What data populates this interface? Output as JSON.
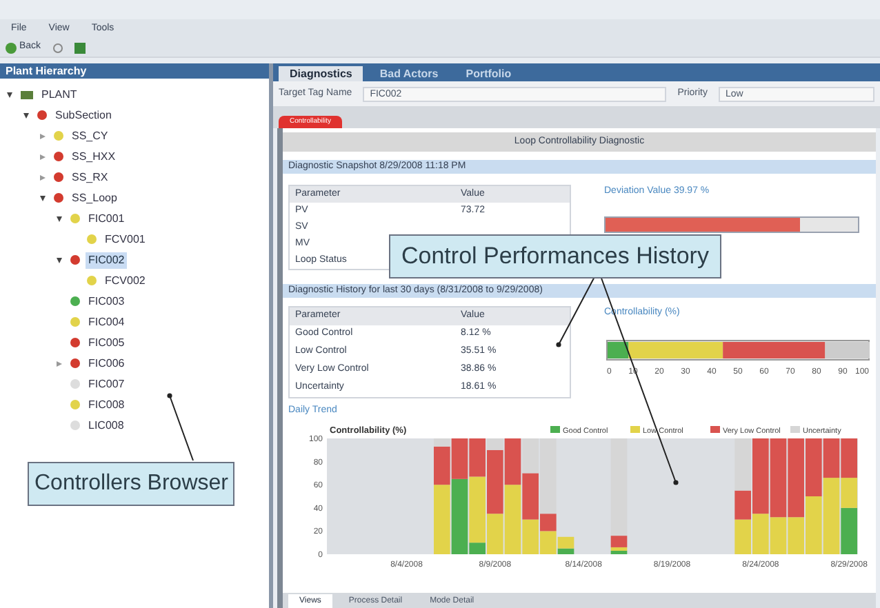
{
  "menu": [
    "File",
    "View",
    "Tools"
  ],
  "toolbar": {
    "back": "Back"
  },
  "hierarchy": {
    "title": "Plant Hierarchy",
    "tree": [
      {
        "label": "PLANT",
        "expanded": true,
        "selected": false,
        "children": [
          {
            "label": "SubSection",
            "color": "#d33b2f",
            "expanded": true,
            "selected": false,
            "children": [
              {
                "label": "SS_CY",
                "color": "#e2d34a",
                "expanded": false,
                "selected": false
              },
              {
                "label": "SS_HXX",
                "color": "#d33b2f",
                "expanded": false,
                "selected": false
              },
              {
                "label": "SS_RX",
                "color": "#d33b2f",
                "expanded": false,
                "selected": false
              },
              {
                "label": "SS_Loop",
                "color": "#d33b2f",
                "expanded": true,
                "selected": false,
                "children": [
                  {
                    "label": "FIC001",
                    "color": "#e2d34a",
                    "expanded": true,
                    "selected": false,
                    "children": [
                      {
                        "label": "FCV001",
                        "color": "#e2d34a",
                        "selected": false
                      }
                    ]
                  },
                  {
                    "label": "FIC002",
                    "color": "#d33b2f",
                    "expanded": true,
                    "selected": true,
                    "children": [
                      {
                        "label": "FCV002",
                        "color": "#e2d34a",
                        "selected": false
                      }
                    ]
                  },
                  {
                    "label": "FIC003",
                    "color": "#4caf50",
                    "selected": false
                  },
                  {
                    "label": "FIC004",
                    "color": "#e2d34a",
                    "selected": false
                  },
                  {
                    "label": "FIC005",
                    "color": "#d33b2f",
                    "selected": false
                  },
                  {
                    "label": "FIC006",
                    "color": "#d33b2f",
                    "expanded": false,
                    "selected": false
                  },
                  {
                    "label": "FIC007",
                    "color": "#dddddd",
                    "selected": false
                  },
                  {
                    "label": "FIC008",
                    "color": "#e2d34a",
                    "selected": false
                  },
                  {
                    "label": "LIC008",
                    "color": "#dddddd",
                    "selected": false
                  }
                ]
              }
            ]
          }
        ]
      }
    ]
  },
  "tabs": [
    {
      "label": "Diagnostics",
      "selected": true
    },
    {
      "label": "Bad Actors",
      "selected": false
    },
    {
      "label": "Portfolio",
      "selected": false
    }
  ],
  "target": {
    "label": "Target Tag Name",
    "value": "FIC002"
  },
  "priority": {
    "label": "Priority",
    "value": "Low"
  },
  "status_tab": {
    "label": "Controllability"
  },
  "panel_title": "Loop Controllability Diagnostic",
  "snapshot": {
    "title": "Diagnostic Snapshot 8/29/2008 11:18 PM",
    "columns": [
      "Parameter",
      "Value"
    ],
    "rows": [
      [
        "PV",
        "73.72"
      ],
      [
        "SV",
        ""
      ],
      [
        "MV",
        ""
      ],
      [
        "Loop Status",
        ""
      ]
    ],
    "meter_title": "Deviation Value 39.97 %",
    "level": 0.77
  },
  "history": {
    "title": "Diagnostic History for last 30 days (8/31/2008 to 9/29/2008)",
    "columns": [
      "Parameter",
      "Value"
    ],
    "rows": [
      [
        "Good Control",
        "8.12 %"
      ],
      [
        "Low Control",
        "35.51 %"
      ],
      [
        "Very Low Control",
        "38.86 %"
      ],
      [
        "Uncertainty",
        "18.61 %"
      ]
    ],
    "bar_title": "Controllability (%)",
    "chart_data": {
      "type": "bar",
      "orientation": "horizontal",
      "stacked": true,
      "categories": [
        null
      ],
      "xlim": [
        0,
        100
      ],
      "xticks": [
        0,
        10,
        20,
        30,
        40,
        50,
        60,
        70,
        80,
        90,
        100
      ],
      "series": [
        {
          "color": "#4caf50",
          "values": [
            8
          ]
        },
        {
          "color": "#e2d34a",
          "values": [
            36
          ]
        },
        {
          "color": "#d9534f",
          "values": [
            39
          ]
        },
        {
          "color": "#cccccc",
          "values": [
            17
          ]
        }
      ]
    }
  },
  "trend": {
    "title": "Daily Trend",
    "chart_data": {
      "type": "bar",
      "stacked": true,
      "title": "Controllability (%)",
      "legend": "top",
      "categories": [
        null,
        null,
        null,
        null,
        "8/4/2008",
        null,
        null,
        null,
        null,
        "8/9/2008",
        null,
        null,
        null,
        null,
        "8/14/2008",
        null,
        null,
        null,
        null,
        "8/19/2008",
        null,
        null,
        null,
        null,
        "8/24/2008",
        null,
        null,
        null,
        null,
        "8/29/2008"
      ],
      "ylim": [
        0,
        100
      ],
      "yticks": [
        0,
        20,
        40,
        60,
        80,
        100
      ],
      "series": [
        {
          "name": "Good Control",
          "color": "#4caf50",
          "values": [
            null,
            null,
            null,
            null,
            null,
            null,
            0,
            65,
            10,
            0,
            0,
            0,
            0,
            5,
            null,
            null,
            3,
            null,
            null,
            null,
            null,
            null,
            null,
            0,
            0,
            0,
            0,
            0,
            0,
            40
          ]
        },
        {
          "name": "Low Control",
          "color": "#e2d34a",
          "values": [
            null,
            null,
            null,
            null,
            null,
            null,
            60,
            0,
            57,
            35,
            60,
            30,
            20,
            10,
            null,
            null,
            3,
            null,
            null,
            null,
            null,
            null,
            null,
            30,
            35,
            32,
            32,
            50,
            66,
            26
          ]
        },
        {
          "name": "Very Low Control",
          "color": "#d9534f",
          "values": [
            null,
            null,
            null,
            null,
            null,
            null,
            33,
            35,
            33,
            55,
            40,
            40,
            15,
            0,
            null,
            null,
            10,
            null,
            null,
            null,
            null,
            null,
            null,
            25,
            65,
            68,
            68,
            50,
            34,
            34
          ]
        },
        {
          "name": "Uncertainty",
          "color": "#d6d6d6",
          "values": [
            null,
            null,
            null,
            null,
            null,
            null,
            7,
            0,
            0,
            10,
            0,
            30,
            65,
            0,
            null,
            null,
            84,
            null,
            null,
            null,
            null,
            null,
            null,
            45,
            0,
            0,
            0,
            0,
            0,
            0
          ]
        }
      ]
    }
  },
  "bottom_tabs": [
    {
      "label": "Views",
      "selected": true
    },
    {
      "label": "Process Detail",
      "selected": false
    },
    {
      "label": "Mode Detail",
      "selected": false
    }
  ],
  "callouts": [
    {
      "text": "Control Performances History"
    },
    {
      "text": "Controllers Browser"
    }
  ]
}
